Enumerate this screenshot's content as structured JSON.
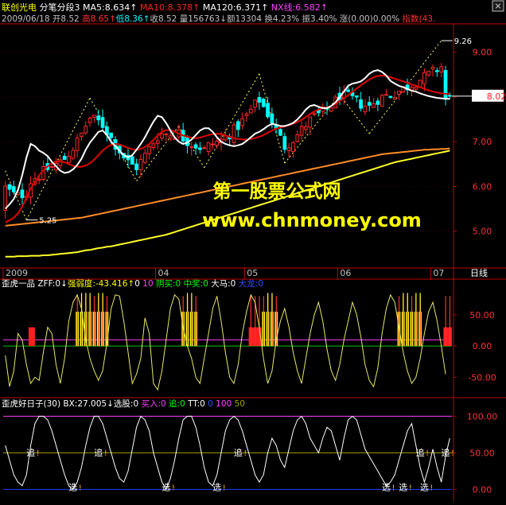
{
  "header": {
    "line1": [
      {
        "text": "联创光电",
        "color": "#ffff00"
      },
      {
        "text": " 分笔分段3 ",
        "color": "#ffffff"
      },
      {
        "text": "MA5:8.634",
        "color": "#ffffff"
      },
      {
        "text": "↑",
        "color": "#ffffff"
      },
      {
        "text": " MA10:8.378",
        "color": "#ff2020"
      },
      {
        "text": "↑",
        "color": "#ff2020"
      },
      {
        "text": " MA120:6.371",
        "color": "#ffffff"
      },
      {
        "text": "↑",
        "color": "#ffffff"
      },
      {
        "text": " NX线:6.582",
        "color": "#ff40ff"
      },
      {
        "text": "↑",
        "color": "#ff40ff"
      }
    ],
    "line2": [
      {
        "text": "2009/06/18 ",
        "color": "#c0c0c0"
      },
      {
        "text": "开8.52 ",
        "color": "#c0c0c0"
      },
      {
        "text": "高8.65",
        "color": "#ff3030"
      },
      {
        "text": "↑",
        "color": "#ff3030"
      },
      {
        "text": "低8.36",
        "color": "#00ffff"
      },
      {
        "text": "↑",
        "color": "#00ffff"
      },
      {
        "text": "收8.52 ",
        "color": "#c0c0c0"
      },
      {
        "text": "量156763",
        "color": "#c0c0c0"
      },
      {
        "text": "↓",
        "color": "#c0c0c0"
      },
      {
        "text": "额13304 ",
        "color": "#c0c0c0"
      },
      {
        "text": "换4.23% ",
        "color": "#c0c0c0"
      },
      {
        "text": "振3.40% ",
        "color": "#c0c0c0"
      },
      {
        "text": "涨(0.00)0.00% ",
        "color": "#c0c0c0"
      },
      {
        "text": "指数(43.",
        "color": "#ff3030"
      }
    ],
    "tab_label": "日线"
  },
  "watermark": {
    "line1": "第一股票公式网",
    "line2": "www.chnmoney.com"
  },
  "colors": {
    "up": "#ff2828",
    "down": "#00ffff",
    "ma5": "#ffffff",
    "ma10": "#e00000",
    "ma120": "#ff8c28",
    "nx": "#ffff28",
    "zigzag": "#ffff60",
    "grid": "#c00000",
    "pink": "#ff40ff",
    "green": "#00c000",
    "blue": "#1e3cff",
    "olive": "#a0a000"
  },
  "chart_data": [
    {
      "type": "candlestick",
      "y_range": [
        4.3,
        9.6
      ],
      "y_ticks": [
        "9.00",
        "8.00",
        "7.00",
        "6.00",
        "5.00"
      ],
      "y_tick_values": [
        9,
        8,
        7,
        6,
        5
      ],
      "x_labels": [
        "2009",
        "04",
        "05",
        "06",
        "07"
      ],
      "x_label_bars": [
        0,
        36,
        57,
        79,
        101
      ],
      "bar_count": 106,
      "series": [
        {
          "name": "MA5",
          "values": [
            5.5,
            5.6,
            5.72,
            5.92,
            6.25,
            6.65,
            6.95,
            6.9,
            6.8,
            6.75,
            6.68,
            6.55,
            6.45,
            6.35,
            6.3,
            6.32,
            6.38,
            6.48,
            6.62,
            6.82,
            6.98,
            7.1,
            7.22,
            7.25,
            7.15,
            7.0,
            6.9,
            6.8,
            6.7,
            6.65,
            6.7,
            6.82,
            6.95,
            7.1,
            7.28,
            7.45,
            7.58,
            7.55,
            7.42,
            7.25,
            7.1,
            7.0,
            6.95,
            6.98,
            7.05,
            7.15,
            7.25,
            7.3,
            7.3,
            7.22,
            7.1,
            7.0,
            6.95,
            6.92,
            6.9,
            6.92,
            6.95,
            7.02,
            7.1,
            7.18,
            7.22,
            7.28,
            7.35,
            7.4,
            7.38,
            7.35,
            7.35,
            7.38,
            7.42,
            7.5,
            7.6,
            7.72,
            7.8,
            7.82,
            7.78,
            7.75,
            7.75,
            7.8,
            7.88,
            8.0,
            8.12,
            8.25,
            8.3,
            8.32,
            8.35,
            8.42,
            8.52,
            8.58,
            8.6,
            8.56,
            8.48,
            8.36,
            8.3,
            8.25,
            8.22,
            8.18,
            8.14,
            8.12,
            8.08,
            8.05,
            8.02,
            8.0,
            7.98,
            7.97,
            7.96,
            7.96
          ]
        },
        {
          "name": "MA10",
          "values": [
            5.2,
            5.24,
            5.3,
            5.4,
            5.55,
            5.75,
            5.95,
            6.1,
            6.25,
            6.36,
            6.45,
            6.52,
            6.56,
            6.56,
            6.54,
            6.5,
            6.46,
            6.44,
            6.44,
            6.47,
            6.52,
            6.6,
            6.7,
            6.8,
            6.88,
            6.93,
            6.95,
            6.94,
            6.9,
            6.86,
            6.83,
            6.82,
            6.84,
            6.88,
            6.95,
            7.04,
            7.14,
            7.22,
            7.26,
            7.26,
            7.23,
            7.18,
            7.14,
            7.11,
            7.09,
            7.08,
            7.09,
            7.12,
            7.15,
            7.17,
            7.18,
            7.17,
            7.14,
            7.11,
            7.08,
            7.06,
            7.05,
            7.05,
            7.06,
            7.08,
            7.11,
            7.15,
            7.2,
            7.25,
            7.29,
            7.32,
            7.34,
            7.37,
            7.4,
            7.44,
            7.49,
            7.55,
            7.62,
            7.68,
            7.72,
            7.75,
            7.77,
            7.8,
            7.85,
            7.91,
            7.97,
            8.04,
            8.12,
            8.19,
            8.26,
            8.33,
            8.39,
            8.44,
            8.47,
            8.48,
            8.47,
            8.44,
            8.41,
            8.38,
            8.35,
            8.32,
            8.28,
            8.25,
            8.22,
            8.18,
            8.15,
            8.12,
            8.1,
            8.08,
            8.07,
            8.06
          ]
        },
        {
          "name": "MA120",
          "values": [
            5.12,
            5.13,
            5.14,
            5.15,
            5.16,
            5.17,
            5.18,
            5.19,
            5.2,
            5.21,
            5.22,
            5.23,
            5.24,
            5.25,
            5.26,
            5.27,
            5.28,
            5.29,
            5.3,
            5.32,
            5.34,
            5.36,
            5.38,
            5.4,
            5.42,
            5.44,
            5.46,
            5.48,
            5.5,
            5.52,
            5.54,
            5.56,
            5.58,
            5.6,
            5.62,
            5.64,
            5.66,
            5.68,
            5.7,
            5.72,
            5.74,
            5.76,
            5.78,
            5.8,
            5.82,
            5.84,
            5.86,
            5.88,
            5.9,
            5.92,
            5.94,
            5.96,
            5.98,
            6.0,
            6.02,
            6.04,
            6.06,
            6.08,
            6.1,
            6.12,
            6.14,
            6.16,
            6.18,
            6.2,
            6.22,
            6.24,
            6.26,
            6.28,
            6.3,
            6.32,
            6.34,
            6.36,
            6.38,
            6.4,
            6.42,
            6.44,
            6.46,
            6.48,
            6.5,
            6.52,
            6.54,
            6.56,
            6.58,
            6.6,
            6.62,
            6.64,
            6.66,
            6.68,
            6.7,
            6.72,
            6.73,
            6.74,
            6.75,
            6.76,
            6.77,
            6.78,
            6.79,
            6.8,
            6.81,
            6.82,
            6.82,
            6.83,
            6.83,
            6.84,
            6.84,
            6.85
          ]
        },
        {
          "name": "NX线",
          "values": [
            4.43,
            4.43,
            4.43,
            4.44,
            4.44,
            4.44,
            4.45,
            4.45,
            4.45,
            4.46,
            4.46,
            4.47,
            4.48,
            4.49,
            4.5,
            4.51,
            4.52,
            4.53,
            4.55,
            4.57,
            4.58,
            4.6,
            4.62,
            4.63,
            4.65,
            4.66,
            4.68,
            4.7,
            4.72,
            4.74,
            4.76,
            4.78,
            4.8,
            4.82,
            4.84,
            4.86,
            4.88,
            4.9,
            4.92,
            4.95,
            4.98,
            5.01,
            5.04,
            5.07,
            5.1,
            5.13,
            5.16,
            5.19,
            5.22,
            5.25,
            5.28,
            5.31,
            5.34,
            5.37,
            5.4,
            5.43,
            5.46,
            5.49,
            5.52,
            5.55,
            5.58,
            5.61,
            5.64,
            5.67,
            5.7,
            5.73,
            5.76,
            5.79,
            5.82,
            5.85,
            5.88,
            5.91,
            5.94,
            5.97,
            6.0,
            6.03,
            6.06,
            6.09,
            6.12,
            6.15,
            6.18,
            6.21,
            6.24,
            6.27,
            6.3,
            6.33,
            6.36,
            6.39,
            6.42,
            6.45,
            6.48,
            6.51,
            6.54,
            6.56,
            6.58,
            6.6,
            6.62,
            6.64,
            6.66,
            6.68,
            6.7,
            6.72,
            6.74,
            6.76,
            6.78,
            6.8
          ]
        }
      ],
      "zigzag": [
        [
          0,
          6.35
        ],
        [
          5,
          5.25
        ],
        [
          20,
          7.98
        ],
        [
          31,
          6.12
        ],
        [
          41,
          7.35
        ],
        [
          47,
          6.42
        ],
        [
          60,
          8.52
        ],
        [
          66,
          6.52
        ],
        [
          79,
          8.05
        ],
        [
          86,
          7.18
        ],
        [
          103,
          9.26
        ]
      ],
      "zigzag_anchor_bars": [
        0,
        5,
        20,
        31,
        41,
        47,
        60,
        66,
        79,
        86,
        103
      ],
      "annotations": [
        {
          "text": "9.26",
          "bar": 103,
          "value": 9.26
        },
        {
          "text": "5.25",
          "bar": 5,
          "value": 5.25
        }
      ],
      "current_price": {
        "text": "8.02",
        "value": 8.02
      }
    },
    {
      "type": "indicator",
      "title": "歪虎一品",
      "legend": [
        {
          "text": "歪虎一品 ",
          "color": "#ffffff"
        },
        {
          "text": "ZFF:0",
          "color": "#ffffff"
        },
        {
          "text": "↓",
          "color": "#ffffff"
        },
        {
          "text": "强弱度:-43.416",
          "color": "#ffff00"
        },
        {
          "text": "↑",
          "color": "#ffff00"
        },
        {
          "text": "0 ",
          "color": "#ffffff"
        },
        {
          "text": "10 ",
          "color": "#ff40ff"
        },
        {
          "text": "阴买:0 ",
          "color": "#00ff00"
        },
        {
          "text": "中奖:0 ",
          "color": "#00ff00"
        },
        {
          "text": "大马:0 ",
          "color": "#ffffff"
        },
        {
          "text": "大龙:0",
          "color": "#3050ff"
        }
      ],
      "y_range": [
        -75,
        88
      ],
      "y_ticks": [
        "50.00",
        "0.00",
        "-50.00"
      ],
      "y_tick_values": [
        50,
        0,
        -50
      ],
      "ref_lines": [
        10,
        0
      ],
      "red_bars": [
        [
          6,
          7.5,
          30
        ],
        [
          58,
          61,
          30
        ],
        [
          104,
          106,
          30
        ]
      ],
      "yellow_bar_groups": [
        [
          17,
          24
        ],
        [
          42,
          45
        ],
        [
          61,
          64
        ],
        [
          93,
          98
        ]
      ],
      "red_cols": [
        17,
        18,
        19,
        20,
        21,
        22,
        23,
        24,
        42,
        43,
        44,
        45,
        58,
        59,
        60,
        61,
        62,
        63,
        64,
        93,
        94,
        95,
        96,
        97,
        98,
        104,
        105
      ],
      "yellow_cols": [
        18,
        19,
        20,
        22,
        23,
        43,
        44,
        62,
        63,
        94,
        95,
        97,
        98
      ],
      "series": [
        {
          "name": "强弱度",
          "values": [
            -15,
            -65,
            -40,
            20,
            10,
            -30,
            -60,
            -50,
            -55,
            -10,
            30,
            20,
            -30,
            -60,
            -20,
            40,
            70,
            82,
            60,
            10,
            -20,
            -40,
            -55,
            -40,
            5,
            60,
            82,
            80,
            40,
            -10,
            -60,
            -45,
            -20,
            45,
            20,
            -60,
            -70,
            -40,
            10,
            60,
            82,
            75,
            30,
            0,
            -20,
            -50,
            -60,
            -20,
            20,
            60,
            80,
            40,
            -10,
            -50,
            -60,
            -30,
            20,
            55,
            82,
            70,
            30,
            -20,
            -60,
            -40,
            10,
            40,
            60,
            30,
            -10,
            -40,
            -60,
            -20,
            20,
            50,
            70,
            40,
            -5,
            -40,
            -55,
            -30,
            10,
            40,
            70,
            50,
            15,
            -30,
            -55,
            -65,
            -35,
            20,
            60,
            82,
            70,
            30,
            -10,
            -40,
            -60,
            -50,
            -20,
            20,
            55,
            70,
            40,
            0,
            -45
          ]
        }
      ]
    },
    {
      "type": "indicator",
      "title": "歪虎好日子(30)",
      "legend": [
        {
          "text": "歪虎好日子(30) ",
          "color": "#ffffff"
        },
        {
          "text": "BX:27.005",
          "color": "#ffffff"
        },
        {
          "text": "↓",
          "color": "#ffffff"
        },
        {
          "text": "选股:0 ",
          "color": "#ffffff"
        },
        {
          "text": "买入:0 ",
          "color": "#ff40ff"
        },
        {
          "text": "追:0 ",
          "color": "#00ff00"
        },
        {
          "text": "TT:0 ",
          "color": "#ffffff"
        },
        {
          "text": "0 ",
          "color": "#3050ff"
        },
        {
          "text": "100 ",
          "color": "#ff40ff"
        },
        {
          "text": "50",
          "color": "#a0a000"
        }
      ],
      "y_range": [
        -5,
        108
      ],
      "y_ticks": [
        "100.00",
        "50.00",
        "0.00"
      ],
      "y_tick_values": [
        100,
        50,
        0
      ],
      "series": [
        {
          "name": "BX",
          "values": [
            60,
            40,
            20,
            10,
            5,
            20,
            60,
            90,
            100,
            100,
            95,
            80,
            60,
            40,
            20,
            5,
            0,
            10,
            30,
            60,
            85,
            100,
            100,
            90,
            70,
            50,
            30,
            15,
            10,
            25,
            55,
            85,
            100,
            95,
            80,
            50,
            30,
            10,
            0,
            15,
            40,
            70,
            95,
            100,
            100,
            85,
            60,
            30,
            10,
            5,
            20,
            50,
            80,
            95,
            100,
            95,
            80,
            60,
            40,
            20,
            10,
            20,
            50,
            70,
            60,
            40,
            30,
            55,
            80,
            95,
            100,
            90,
            70,
            60,
            50,
            70,
            85,
            80,
            60,
            40,
            70,
            95,
            100,
            95,
            75,
            55,
            45,
            35,
            25,
            15,
            5,
            10,
            20,
            40,
            60,
            80,
            90,
            60,
            30,
            10,
            30,
            55,
            30,
            10,
            45,
            70
          ]
        }
      ],
      "labels": [
        {
          "text": "追",
          "bar": 6,
          "value": 46,
          "color": "#ffffff"
        },
        {
          "text": "追",
          "bar": 22,
          "value": 46,
          "color": "#ffffff"
        },
        {
          "text": "追",
          "bar": 55,
          "value": 46,
          "color": "#ffffff"
        },
        {
          "text": "追",
          "bar": 98,
          "value": 46,
          "color": "#ffffff"
        },
        {
          "text": "追",
          "bar": 104,
          "value": 46,
          "color": "#ffffff"
        },
        {
          "text": "选",
          "bar": 16,
          "value": -1,
          "color": "#ffffff"
        },
        {
          "text": "选",
          "bar": 38,
          "value": -1,
          "color": "#ffffff"
        },
        {
          "text": "选",
          "bar": 50,
          "value": -1,
          "color": "#ffffff"
        },
        {
          "text": "选",
          "bar": 90,
          "value": -1,
          "color": "#ffffff"
        },
        {
          "text": "选",
          "bar": 94,
          "value": -1,
          "color": "#ffffff"
        },
        {
          "text": "选",
          "bar": 99,
          "value": -1,
          "color": "#ffffff"
        }
      ]
    }
  ]
}
